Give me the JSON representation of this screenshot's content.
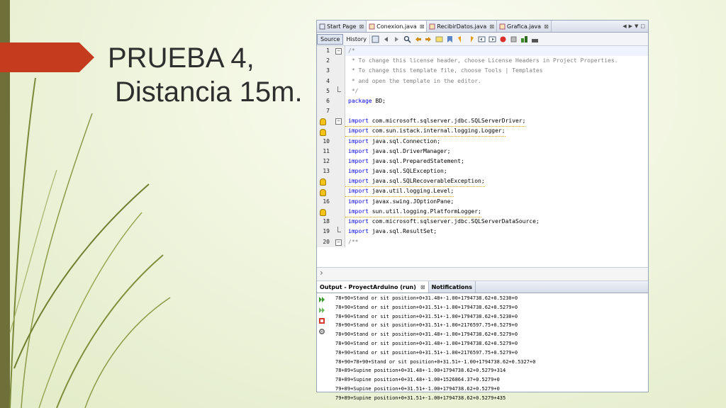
{
  "slide": {
    "title_line1": "PRUEBA 4,",
    "title_line2": "Distancia 15m."
  },
  "ide": {
    "tabs": [
      {
        "label": "Start Page",
        "active": false
      },
      {
        "label": "Conexion.java",
        "active": true
      },
      {
        "label": "RecibirDatos.java",
        "active": false
      },
      {
        "label": "Grafica.java",
        "active": false
      }
    ],
    "toolbar": {
      "source_label": "Source",
      "history_label": "History"
    },
    "code_lines": [
      {
        "num": "1",
        "text": "/*"
      },
      {
        "num": "2",
        "text": " * To change this license header, choose License Headers in Project Properties."
      },
      {
        "num": "3",
        "text": " * To change this template file, choose Tools | Templates"
      },
      {
        "num": "4",
        "text": " * and open the template in the editor."
      },
      {
        "num": "5",
        "text": " */"
      },
      {
        "num": "6",
        "text": "package BD;"
      },
      {
        "num": "7",
        "text": ""
      },
      {
        "num": "",
        "text": "import com.microsoft.sqlserver.jdbc.SQLServerDriver;"
      },
      {
        "num": "",
        "text": "import com.sun.istack.internal.logging.Logger;"
      },
      {
        "num": "10",
        "text": "import java.sql.Connection;"
      },
      {
        "num": "11",
        "text": "import java.sql.DriverManager;"
      },
      {
        "num": "12",
        "text": "import java.sql.PreparedStatement;"
      },
      {
        "num": "13",
        "text": "import java.sql.SQLException;"
      },
      {
        "num": "",
        "text": "import java.sql.SQLRecoverableException;"
      },
      {
        "num": "",
        "text": "import java.util.logging.Level;"
      },
      {
        "num": "16",
        "text": "import javax.swing.JOptionPane;"
      },
      {
        "num": "",
        "text": "import sun.util.logging.PlatformLogger;"
      },
      {
        "num": "18",
        "text": "import com.microsoft.sqlserver.jdbc.SQLServerDataSource;"
      },
      {
        "num": "19",
        "text": "import java.sql.ResultSet;"
      },
      {
        "num": "20",
        "text": "/**"
      }
    ],
    "output_tabs": [
      {
        "label": "Output - ProyectArduino (run)",
        "active": true
      },
      {
        "label": "Notifications",
        "active": false
      }
    ],
    "output_lines": [
      "78+90+Stand or sit position+0+31.48+-1.00+1794738.62+0.5230+0",
      "78+90+Stand or sit position+0+31.51+-1.00+1794738.62+0.5279+0",
      "78+90+Stand or sit position+0+31.51+-1.00+1794738.62+0.5230+0",
      "78+90+Stand or sit position+0+31.51+-1.00+2176597.75+0.5279+0",
      "78+90+Stand or sit position+0+31.48+-1.00+1794738.62+0.5279+0",
      "78+90+Stand or sit position+0+31.48+-1.00+1794738.62+0.5279+0",
      "78+90+Stand or sit position+0+31.51+-1.00+2176597.75+0.5279+0",
      "78+90+78+90+Stand or sit position+0+31.51+-1.00+1794738.62+0.5327+0",
      "78+89+Supine position+0+31.48+-1.00+1794738.62+0.5279+314",
      "78+89+Supine position+0+31.48+-1.00+1526864.37+0.5279+0",
      "79+89+Supine position+0+31.51+-1.00+1794738.62+0.5279+0",
      "79+89+Supine position+0+31.51+-1.00+1794738.62+0.5279+435"
    ]
  }
}
